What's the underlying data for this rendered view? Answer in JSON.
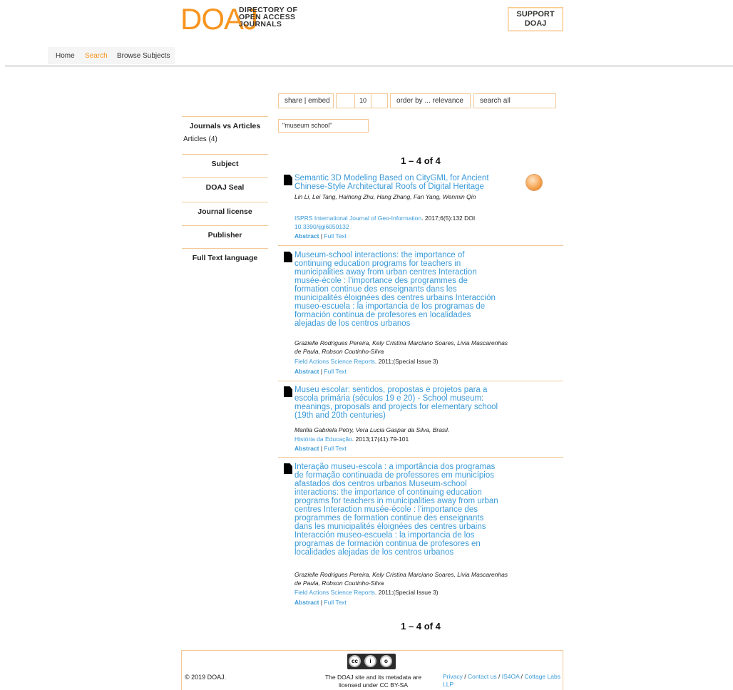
{
  "header": {
    "logo_mark": "DOAJ",
    "logo_line1": "DIRECTORY OF",
    "logo_line2": "OPEN ACCESS",
    "logo_line3": "JOURNALS",
    "support_line1": "SUPPORT",
    "support_line2": "DOAJ"
  },
  "nav": {
    "home": "Home",
    "search": "Search",
    "browse": "Browse Subjects"
  },
  "controls": {
    "share": "share | embed",
    "page_size": "10",
    "order": "order by ... relevance",
    "search_field": "search all",
    "query": "\"museum school\""
  },
  "facets": {
    "journals_vs_articles": "Journals vs Articles",
    "articles_count": "Articles (4)",
    "subject": "Subject",
    "seal": "DOAJ Seal",
    "license": "Journal license",
    "publisher": "Publisher",
    "language": "Full Text language"
  },
  "results_count": "1 – 4 of 4",
  "results": [
    {
      "title": "Semantic 3D Modeling Based on CityGML for Ancient Chinese-Style Architectural Roofs of Digital Heritage",
      "authors": "Lin Li, Lei Tang, Haihong Zhu, Hang Zhang, Fan Yang, Wenmin Qin",
      "journal": "ISPRS International Journal of Geo-Information",
      "details": ". 2017;6(5):132 DOI",
      "doi": "10.3390/ijgi6050132",
      "abstract": "Abstract",
      "sep": " | ",
      "fulltext": "Full Text"
    },
    {
      "title": "Museum-school interactions: the importance of continuing education programs for teachers in municipalities away from urban centres Interaction musée-école : l’importance des programmes de formation continue des enseignants dans les municipalités éloignées des centres urbains Interacción museo-escuela : la importancia de los programas de formación continua de profesores en localidades alejadas de los centros urbanos",
      "authors": "Grazielle Rodrigues Pereira, Kely Cristina Marciano Soares, Livia Mascarenhas de Paula, Robson Coutinho-Silva",
      "journal": "Field Actions Science Reports",
      "details": ". 2011;(Special Issue 3)",
      "abstract": "Abstract",
      "sep": " | ",
      "fulltext": "Full Text"
    },
    {
      "title": "Museu escolar: sentidos, propostas e projetos para a escola primária (séculos 19 e 20) - School museum: meanings, proposals and projects for elementary school (19th and 20th centuries)",
      "authors": "Marilia Gabriela Petry, Vera Lucia Gaspar da Silva, Brasil.",
      "journal": "História da Educação",
      "details": ". 2013;17(41):79-101",
      "abstract": "Abstract",
      "sep": " | ",
      "fulltext": "Full Text"
    },
    {
      "title": "Interação museu-escola : a importância dos programas de formação continuada de professores em municípios afastados dos centros urbanos Museum-school interactions: the importance of continuing education programs for teachers in municipalities away from urban centres Interaction musée-école : l’importance des programmes de formation continue des enseignants dans les municipalités éloignées des centres urbains Interacción museo-escuela : la importancia de los programas de formación continua de profesores en localidades alejadas de los centros urbanos",
      "authors": "Grazielle Rodrigues Pereira, Kely Cristina Marciano Soares, Livia Mascarenhas de Paula, Robson Coutinho-Silva",
      "journal": "Field Actions Science Reports",
      "details": ". 2011;(Special Issue 3)",
      "abstract": "Abstract",
      "sep": " | ",
      "fulltext": "Full Text"
    }
  ],
  "footer": {
    "copyright": "© 2019 DOAJ.",
    "license": "The DOAJ site and its metadata are licensed under CC BY-SA",
    "privacy": "Privacy",
    "contact": "Contact us",
    "is4oa": "IS4OA",
    "cottage": "Cottage Labs LLP",
    "slash": " / "
  },
  "colors": {
    "brand_orange": "#f7941e",
    "link_blue": "#3a9ad9",
    "border_orange": "#f3c895"
  }
}
